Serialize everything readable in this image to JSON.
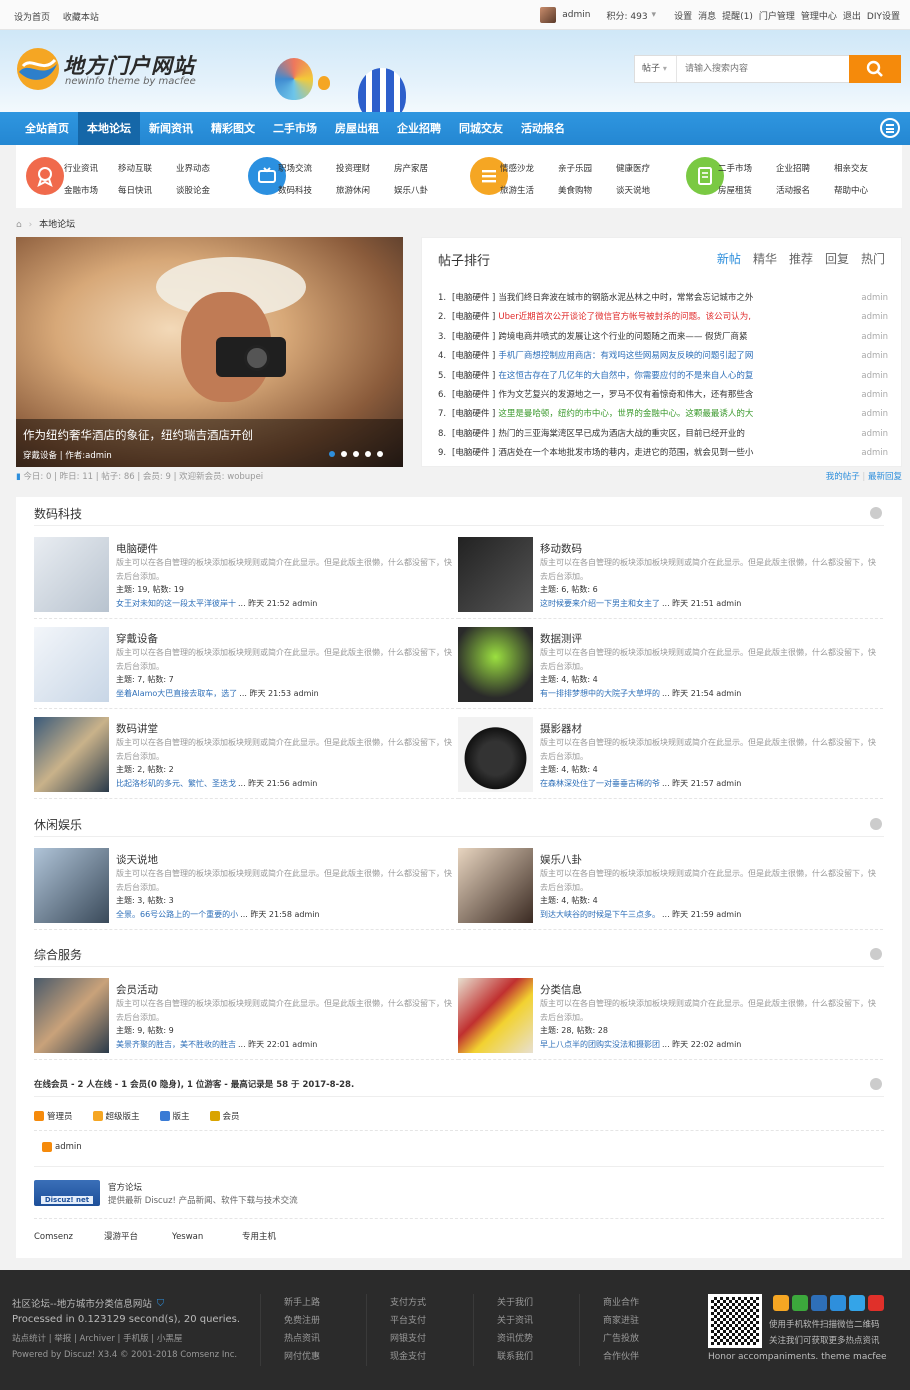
{
  "topbar": {
    "left": [
      "设为首页",
      "收藏本站"
    ],
    "username": "admin",
    "points": "积分: 493",
    "links": [
      "设置",
      "消息",
      "提醒(1)",
      "门户管理",
      "管理中心",
      "退出",
      "DIY设置"
    ]
  },
  "header": {
    "logo_title": "地方门户网站",
    "logo_sub": "newinfo theme by macfee",
    "search_scope": "帖子",
    "search_placeholder": "请输入搜索内容"
  },
  "nav": {
    "items": [
      "全站首页",
      "本地论坛",
      "新闻资讯",
      "精彩图文",
      "二手市场",
      "房屋出租",
      "企业招聘",
      "同城交友",
      "活动报名"
    ],
    "active": 1
  },
  "subnav": {
    "groups": [
      {
        "icon": "award-icon",
        "color": "#f06a4c",
        "links": [
          "行业资讯",
          "移动互联",
          "业界动态",
          "金融市场",
          "每日快讯",
          "谈股论金"
        ]
      },
      {
        "icon": "tv-icon",
        "color": "#2b90e0",
        "links": [
          "职场交流",
          "投资理财",
          "房产家居",
          "数码科技",
          "旅游休闲",
          "娱乐八卦"
        ]
      },
      {
        "icon": "list-icon",
        "color": "#f5a623",
        "links": [
          "情感沙龙",
          "亲子乐园",
          "健康医疗",
          "旅游生活",
          "美食购物",
          "谈天说地"
        ]
      },
      {
        "icon": "document-icon",
        "color": "#7ac943",
        "links": [
          "二手市场",
          "企业招聘",
          "相亲交友",
          "房屋租赁",
          "活动报名",
          "帮助中心"
        ]
      }
    ]
  },
  "breadcrumb": {
    "current": "本地论坛"
  },
  "carousel": {
    "caption": "作为纽约奢华酒店的象征，纽约瑞吉酒店开创",
    "meta": "穿戴设备 | 作者:admin",
    "slides": 5,
    "active": 0
  },
  "hot": {
    "title": "帖子排行",
    "tabs": [
      "新帖",
      "精华",
      "推荐",
      "回复",
      "热门"
    ],
    "active_tab": 0,
    "items": [
      {
        "n": "1.",
        "cat": "[电脑硬件 ]",
        "text": "当我们终日奔波在城市的钢筋水泥丛林之中时，常常会忘记城市之外",
        "color": "#333333",
        "author": "admin"
      },
      {
        "n": "2.",
        "cat": "[电脑硬件 ]",
        "text": "Uber近期首次公开谈论了微信官方帐号被封杀的问题。该公司认为,",
        "color": "#e02a2a",
        "author": "admin"
      },
      {
        "n": "3.",
        "cat": "[电脑硬件 ]",
        "text": "跨境电商井喷式的发展让这个行业的问题随之而来—— 假货厂商紧",
        "color": "#333333",
        "author": "admin"
      },
      {
        "n": "4.",
        "cat": "[电脑硬件 ]",
        "text": "手机厂商想控制应用商店：有戏吗这些网易网友反映的问题引起了网",
        "color": "#2e6fb8",
        "author": "admin"
      },
      {
        "n": "5.",
        "cat": "[电脑硬件 ]",
        "text": "在这恒古存在了几亿年的大自然中，你需要应付的不是来自人心的复",
        "color": "#2e6fb8",
        "author": "admin"
      },
      {
        "n": "6.",
        "cat": "[电脑硬件 ]",
        "text": "作为文艺复兴的发源地之一，罗马不仅有着惊奇和伟大，还有那些含",
        "color": "#333333",
        "author": "admin"
      },
      {
        "n": "7.",
        "cat": "[电脑硬件 ]",
        "text": "这里是曼哈顿，纽约的市中心，世界的金融中心。这颗最最诱人的大",
        "color": "#3c9a2e",
        "author": "admin"
      },
      {
        "n": "8.",
        "cat": "[电脑硬件 ]",
        "text": "热门的三亚海棠湾区早已成为酒店大战的重灾区，目前已经开业的",
        "color": "#333333",
        "author": "admin"
      },
      {
        "n": "9.",
        "cat": "[电脑硬件 ]",
        "text": "酒店处在一个本地批发市场的巷内，走进它的范围，就会见到一些小",
        "color": "#333333",
        "author": "admin"
      }
    ]
  },
  "stats": {
    "text": "今日: 0 | 昨日: 11 | 帖子: 86 | 会员: 9 | 欢迎新会员: wobupei",
    "my_posts": "我的帖子",
    "latest": "最新回复"
  },
  "boards": [
    {
      "title": "数码科技",
      "forums": [
        {
          "name": "电脑硬件",
          "desc": "版主可以在各自管理的板块添加板块规则或简介在此显示。但是此版主很懒，什么都没留下，快去后台添加。",
          "count": "主题: 19, 帖数: 19",
          "last_link": "女王对未知的这一段太平洋彼岸十",
          "last_time": "... 昨天 21:52 admin",
          "img": "appletv"
        },
        {
          "name": "移动数码",
          "desc": "版主可以在各自管理的板块添加板块规则或简介在此显示。但是此版主很懒，什么都没留下，快去后台添加。",
          "count": "主题: 6, 帖数: 6",
          "last_link": "这时候要来介绍一下男主和女主了",
          "last_time": "... 昨天 21:51 admin",
          "img": "tablet"
        },
        {
          "name": "穿戴设备",
          "desc": "版主可以在各自管理的板块添加板块规则或简介在此显示。但是此版主很懒，什么都没留下，快去后台添加。",
          "count": "主题: 7, 帖数: 7",
          "last_link": "坐着Alamo大巴直接去取车，选了",
          "last_time": "... 昨天 21:53 admin",
          "img": "watch"
        },
        {
          "name": "数据测评",
          "desc": "版主可以在各自管理的板块添加板块规则或简介在此显示。但是此版主很懒，什么都没留下，快去后台添加。",
          "count": "主题: 4, 帖数: 4",
          "last_link": "有一排排梦想中的大院子大草坪的",
          "last_time": "... 昨天 21:54 admin",
          "img": "nvidia"
        },
        {
          "name": "数码讲堂",
          "desc": "版主可以在各自管理的板块添加板块规则或简介在此显示。但是此版主很懒，什么都没留下，快去后台添加。",
          "count": "主题: 2, 帖数: 2",
          "last_link": "比起洛杉矶的多元、繁忙、圣迭戈",
          "last_time": "... 昨天 21:56 admin",
          "img": "board"
        },
        {
          "name": "摄影器材",
          "desc": "版主可以在各自管理的板块添加板块规则或简介在此显示。但是此版主很懒，什么都没留下，快去后台添加。",
          "count": "主题: 4, 帖数: 4",
          "last_link": "在森林深处住了一对垂垂古稀的爷",
          "last_time": "... 昨天 21:57 admin",
          "img": "camera"
        }
      ]
    },
    {
      "title": "休闲娱乐",
      "forums": [
        {
          "name": "谈天说地",
          "desc": "版主可以在各自管理的板块添加板块规则或简介在此显示。但是此版主很懒，什么都没留下，快去后台添加。",
          "count": "主题: 3, 帖数: 3",
          "last_link": "全景。66号公路上的一个重要的小",
          "last_time": "... 昨天 21:58 admin",
          "img": "man"
        },
        {
          "name": "娱乐八卦",
          "desc": "版主可以在各自管理的板块添加板块规则或简介在此显示。但是此版主很懒，什么都没留下，快去后台添加。",
          "count": "主题: 4, 帖数: 4",
          "last_link": "到达大峡谷的时候是下午三点多。",
          "last_time": "... 昨天 21:59 admin",
          "img": "woman"
        }
      ]
    },
    {
      "title": "综合服务",
      "forums": [
        {
          "name": "会员活动",
          "desc": "版主可以在各自管理的板块添加板块规则或简介在此显示。但是此版主很懒，什么都没留下，快去后台添加。",
          "count": "主题: 9, 帖数: 9",
          "last_link": "美景齐聚的胜吉，美不胜收的胜吉",
          "last_time": "... 昨天 22:01 admin",
          "img": "meeting"
        },
        {
          "name": "分类信息",
          "desc": "版主可以在各自管理的板块添加板块规则或简介在此显示。但是此版主很懒，什么都没留下，快去后台添加。",
          "count": "主题: 28, 帖数: 28",
          "last_link": "早上八点半的团购实没法和摄影团",
          "last_time": "... 昨天 22:02 admin",
          "img": "paper"
        }
      ]
    }
  ],
  "online": {
    "summary": "在线会员 - 2 人在线 - 1 会员(0 隐身), 1 位游客 - 最高记录是 58 于 2017-8-28.",
    "legend": [
      {
        "label": "管理员",
        "color": "#f58a0b"
      },
      {
        "label": "超级版主",
        "color": "#f5a623"
      },
      {
        "label": "版主",
        "color": "#3a7bd5"
      },
      {
        "label": "会员",
        "color": "#d9a400"
      }
    ],
    "user": "admin"
  },
  "friendlinks": {
    "main_title": "官方论坛",
    "main_desc": "提供最新 Discuz! 产品新闻、软件下载与技术交流",
    "logo_text": "Discuz! net",
    "items": [
      "Comsenz",
      "漫游平台",
      "Yeswan",
      "专用主机"
    ]
  },
  "footer": {
    "site": "社区论坛--地方城市分类信息网站",
    "processed": "Processed in 0.123129 second(s), 20 queries.",
    "bottom_links": "站点统计 | 举报 | Archiver | 手机版 | 小黑屋",
    "powered": "Powered by Discuz! X3.4 © 2001-2018 Comsenz Inc.",
    "cols": [
      [
        "新手上路",
        "免费注册",
        "热点资讯",
        "网付优惠"
      ],
      [
        "支付方式",
        "平台支付",
        "网银支付",
        "现金支付"
      ],
      [
        "关于我们",
        "关于资讯",
        "资讯优势",
        "联系我们"
      ],
      [
        "商业合作",
        "商家进驻",
        "广告投放",
        "合作伙伴"
      ]
    ],
    "qr_text1": "使用手机软件扫描微信二维码",
    "qr_text2": "关注我们可获取更多热点资讯",
    "slogan": "Honor accompaniments. theme macfee"
  }
}
